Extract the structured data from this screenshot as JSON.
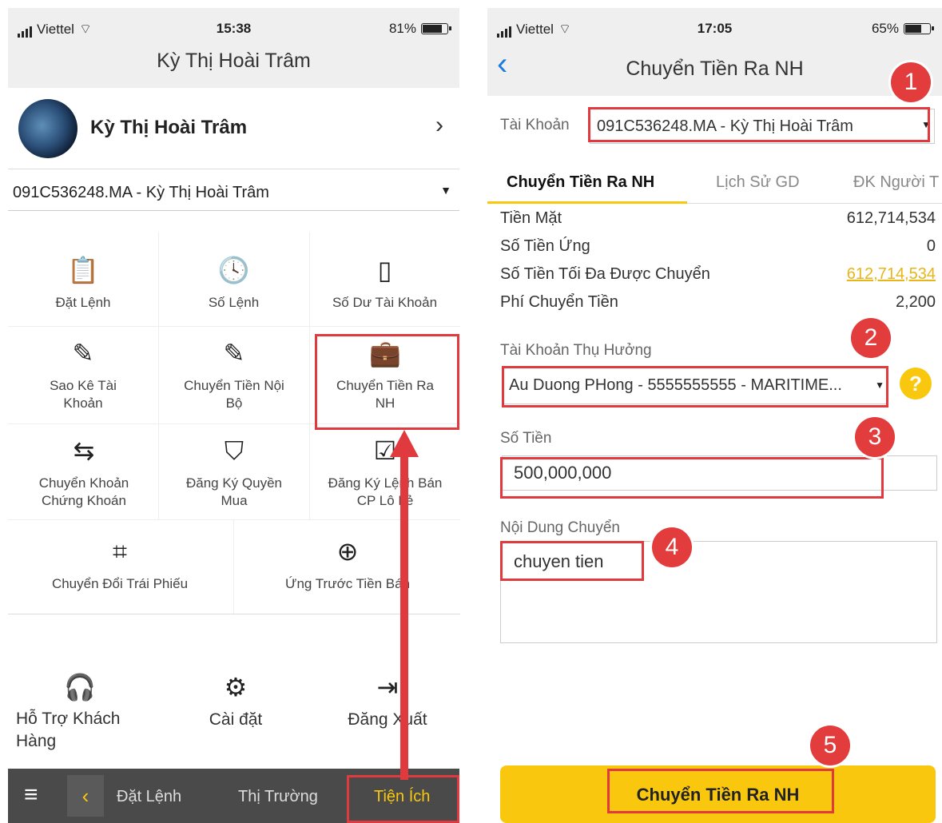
{
  "left": {
    "status": {
      "carrier": "Viettel",
      "time": "15:38",
      "battery": "81%"
    },
    "header_title": "Kỳ Thị Hoài Trâm",
    "profile_name": "Kỳ Thị Hoài Trâm",
    "account": "091C536248.MA - Kỳ Thị Hoài Trâm",
    "grid": [
      {
        "label": "Đặt Lệnh",
        "icon": "clipboard-check-icon"
      },
      {
        "label": "Số Lệnh",
        "icon": "clock-icon"
      },
      {
        "label": "Số Dư Tài Khoản",
        "icon": "clipboard-icon"
      },
      {
        "label": "Sao Kê Tài Khoản",
        "icon": "edit-icon"
      },
      {
        "label": "Chuyển Tiền Nội Bộ",
        "icon": "edit-icon"
      },
      {
        "label": "Chuyển Tiền Ra NH",
        "icon": "wallet-icon"
      },
      {
        "label": "Chuyển Khoản Chứng Khoán",
        "icon": "swap-icon"
      },
      {
        "label": "Đăng Ký Quyền Mua",
        "icon": "shield-check-icon"
      },
      {
        "label": "Đăng Ký Lệnh Bán CP Lô Lẻ",
        "icon": "clipboard-check-icon"
      },
      {
        "label": "Chuyển Đổi Trái Phiếu",
        "icon": "crop-icon"
      },
      {
        "label": "Ứng Trước Tiền Bán",
        "icon": "lifebuoy-icon"
      }
    ],
    "bottom": [
      {
        "label": "Hỗ Trợ Khách Hàng",
        "icon": "headset-icon"
      },
      {
        "label": "Cài đặt",
        "icon": "gear-icon"
      },
      {
        "label": "Đăng Xuất",
        "icon": "logout-icon"
      }
    ],
    "tabbar": {
      "t1": "Đặt Lệnh",
      "t2": "Thị Trường",
      "t3": "Tiện Ích"
    }
  },
  "right": {
    "status": {
      "carrier": "Viettel",
      "time": "17:05",
      "battery": "65%"
    },
    "title": "Chuyển Tiền Ra NH",
    "account_label": "Tài Khoản",
    "account_value": "091C536248.MA - Kỳ Thị Hoài Trâm",
    "tabs": [
      "Chuyển Tiền Ra NH",
      "Lịch Sử GD",
      "ĐK Người T"
    ],
    "info": [
      {
        "label": "Tiền Mặt",
        "value": "612,714,534"
      },
      {
        "label": "Số Tiền Ứng",
        "value": "0"
      },
      {
        "label": "Số Tiền Tối Đa Được Chuyển",
        "value": "612,714,534"
      },
      {
        "label": "Phí Chuyển Tiền",
        "value": "2,200"
      }
    ],
    "beneficiary_label": "Tài Khoản Thụ Hưởng",
    "beneficiary_value": "Au Duong PHong - 5555555555 - MARITIME...",
    "amount_label": "Số Tiền",
    "amount_value": "500,000,000",
    "content_label": "Nội Dung Chuyển",
    "content_value": "chuyen tien",
    "submit_label": "Chuyển Tiền Ra NH"
  },
  "steps": [
    "1",
    "2",
    "3",
    "4",
    "5"
  ],
  "colors": {
    "highlight": "#e0393e",
    "accent": "#f9c80e",
    "link": "#1e7ce0",
    "max_value": "#e8b51a"
  }
}
